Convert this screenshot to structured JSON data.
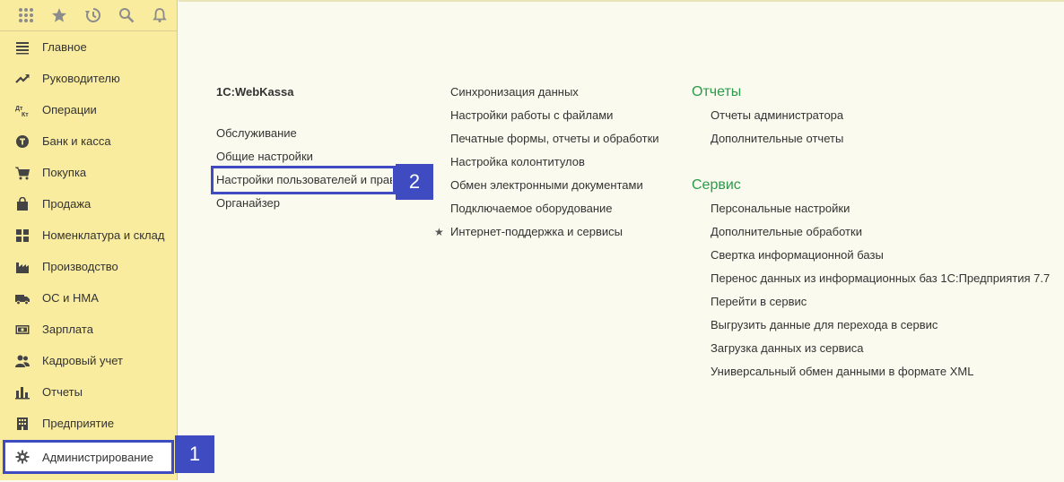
{
  "topbar": {
    "icons": [
      "apps-grid-icon",
      "star-icon",
      "history-icon",
      "search-icon",
      "bell-icon"
    ]
  },
  "sidebar": {
    "items": [
      {
        "label": "Главное",
        "icon": "menu-icon"
      },
      {
        "label": "Руководителю",
        "icon": "trend-icon"
      },
      {
        "label": "Операции",
        "icon": "dt-kt-icon"
      },
      {
        "label": "Банк и касса",
        "icon": "coin-icon"
      },
      {
        "label": "Покупка",
        "icon": "cart-icon"
      },
      {
        "label": "Продажа",
        "icon": "bag-icon"
      },
      {
        "label": "Номенклатура и склад",
        "icon": "grid-icon"
      },
      {
        "label": "Производство",
        "icon": "factory-icon"
      },
      {
        "label": "ОС и НМА",
        "icon": "truck-icon"
      },
      {
        "label": "Зарплата",
        "icon": "money-icon"
      },
      {
        "label": "Кадровый учет",
        "icon": "people-icon"
      },
      {
        "label": "Отчеты",
        "icon": "bar-chart-icon"
      },
      {
        "label": "Предприятие",
        "icon": "building-icon"
      },
      {
        "label": "Администрирование",
        "icon": "gear-icon",
        "active": true
      }
    ]
  },
  "badges": {
    "one": "1",
    "two": "2"
  },
  "col1": {
    "title": "1С:WebKassa",
    "links": [
      "Обслуживание",
      "Общие настройки",
      "Настройки пользователей и прав",
      "Органайзер"
    ]
  },
  "col2": {
    "links": [
      "Синхронизация данных",
      "Настройки работы с файлами",
      "Печатные формы, отчеты и обработки",
      "Настройка колонтитулов",
      "Обмен электронными документами",
      "Подключаемое оборудование",
      "Интернет-поддержка и сервисы"
    ],
    "star": "★"
  },
  "col3": {
    "reports_title": "Отчеты",
    "reports": [
      "Отчеты администратора",
      "Дополнительные отчеты"
    ],
    "service_title": "Сервис",
    "service": [
      "Персональные настройки",
      "Дополнительные обработки",
      "Свертка информационной базы",
      "Перенос данных из информационных баз 1С:Предприятия 7.7",
      "Перейти в сервис",
      "Выгрузить данные для перехода в сервис",
      "Загрузка данных из сервиса",
      "Универсальный обмен данными в формате XML"
    ]
  },
  "colors": {
    "accent": "#3f4bc1",
    "section": "#2b9a4a",
    "sidebar": "#faec9e",
    "background": "#fbfaee"
  }
}
